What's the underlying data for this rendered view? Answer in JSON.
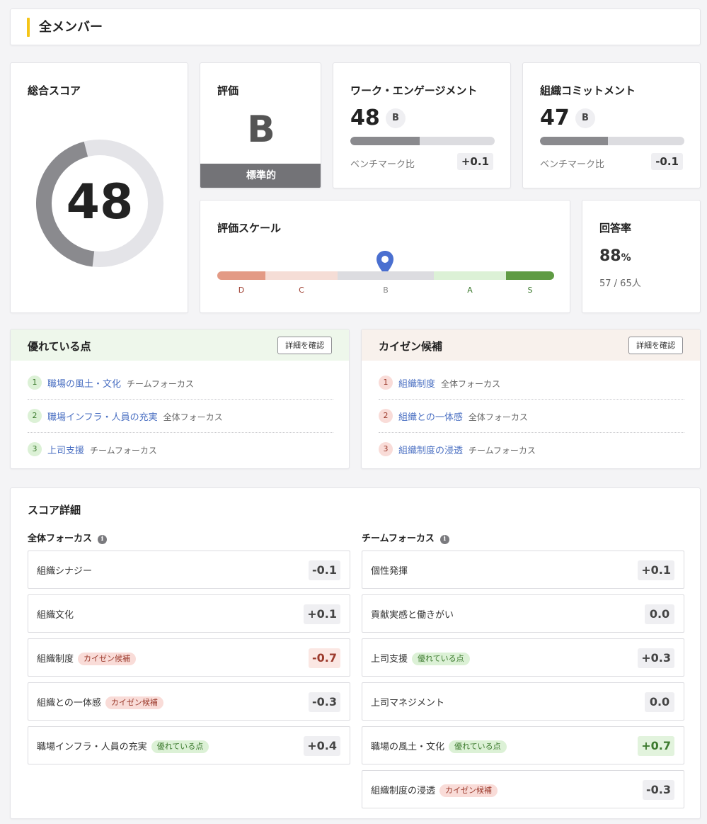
{
  "header": {
    "title": "全メンバー"
  },
  "total": {
    "title": "総合スコア",
    "value": "48",
    "ratio": 0.48,
    "color_fill": "#8a8a8e",
    "color_track": "#e4e4e8"
  },
  "rating": {
    "title": "評価",
    "grade": "B",
    "band": "標準的"
  },
  "engagement": {
    "title": "ワーク・エンゲージメント",
    "value": "48",
    "grade": "B",
    "ratio": 0.48,
    "bench_label": "ベンチマーク比",
    "bench_value": "+0.1"
  },
  "commitment": {
    "title": "組織コミットメント",
    "value": "47",
    "grade": "B",
    "ratio": 0.47,
    "bench_label": "ベンチマーク比",
    "bench_value": "-0.1"
  },
  "scale": {
    "title": "評価スケール",
    "current": "B",
    "segments": [
      {
        "label": "D",
        "color": "#e39a85",
        "label_color": "#9c3a2c"
      },
      {
        "label": "C",
        "color": "#f5ddd6",
        "label_color": "#9c3a2c"
      },
      {
        "label": "B",
        "color": "#dcdce0",
        "label_color": "#888888"
      },
      {
        "label": "A",
        "color": "#dcf1d6",
        "label_color": "#3d7b2f"
      },
      {
        "label": "S",
        "color": "#5f9b43",
        "label_color": "#3d7b2f"
      }
    ],
    "pin_color": "#4a6fd0"
  },
  "response": {
    "title": "回答率",
    "percent": "88",
    "unit": "%",
    "count": "57 / 65人"
  },
  "strengths": {
    "title": "優れている点",
    "button": "詳細を確認",
    "header_bg": "#eef7eb",
    "items": [
      {
        "num": "1",
        "title": "職場の風土・文化",
        "sub": "チームフォーカス"
      },
      {
        "num": "2",
        "title": "職場インフラ・人員の充実",
        "sub": "全体フォーカス"
      },
      {
        "num": "3",
        "title": "上司支援",
        "sub": "チームフォーカス"
      }
    ]
  },
  "kaizen": {
    "title": "カイゼン候補",
    "button": "詳細を確認",
    "header_bg": "#f8f1ec",
    "items": [
      {
        "num": "1",
        "title": "組織制度",
        "sub": "全体フォーカス"
      },
      {
        "num": "2",
        "title": "組織との一体感",
        "sub": "全体フォーカス"
      },
      {
        "num": "3",
        "title": "組織制度の浸透",
        "sub": "チームフォーカス"
      }
    ]
  },
  "detail": {
    "title": "スコア詳細",
    "left": {
      "header": "全体フォーカス",
      "rows": [
        {
          "label": "組織シナジー",
          "tag": "",
          "value": "-0.1",
          "tone": "neutral"
        },
        {
          "label": "組織文化",
          "tag": "",
          "value": "+0.1",
          "tone": "neutral"
        },
        {
          "label": "組織制度",
          "tag": "カイゼン候補",
          "value": "-0.7",
          "tone": "neg"
        },
        {
          "label": "組織との一体感",
          "tag": "カイゼン候補",
          "value": "-0.3",
          "tone": "neutral"
        },
        {
          "label": "職場インフラ・人員の充実",
          "tag": "優れている点",
          "value": "+0.4",
          "tone": "neutral"
        }
      ]
    },
    "right": {
      "header": "チームフォーカス",
      "rows": [
        {
          "label": "個性発揮",
          "tag": "",
          "value": "+0.1",
          "tone": "neutral"
        },
        {
          "label": "貢献実感と働きがい",
          "tag": "",
          "value": "0.0",
          "tone": "neutral"
        },
        {
          "label": "上司支援",
          "tag": "優れている点",
          "value": "+0.3",
          "tone": "neutral"
        },
        {
          "label": "上司マネジメント",
          "tag": "",
          "value": "0.0",
          "tone": "neutral"
        },
        {
          "label": "職場の風土・文化",
          "tag": "優れている点",
          "value": "+0.7",
          "tone": "pos"
        },
        {
          "label": "組織制度の浸透",
          "tag": "カイゼン候補",
          "value": "-0.3",
          "tone": "neutral"
        }
      ]
    }
  }
}
